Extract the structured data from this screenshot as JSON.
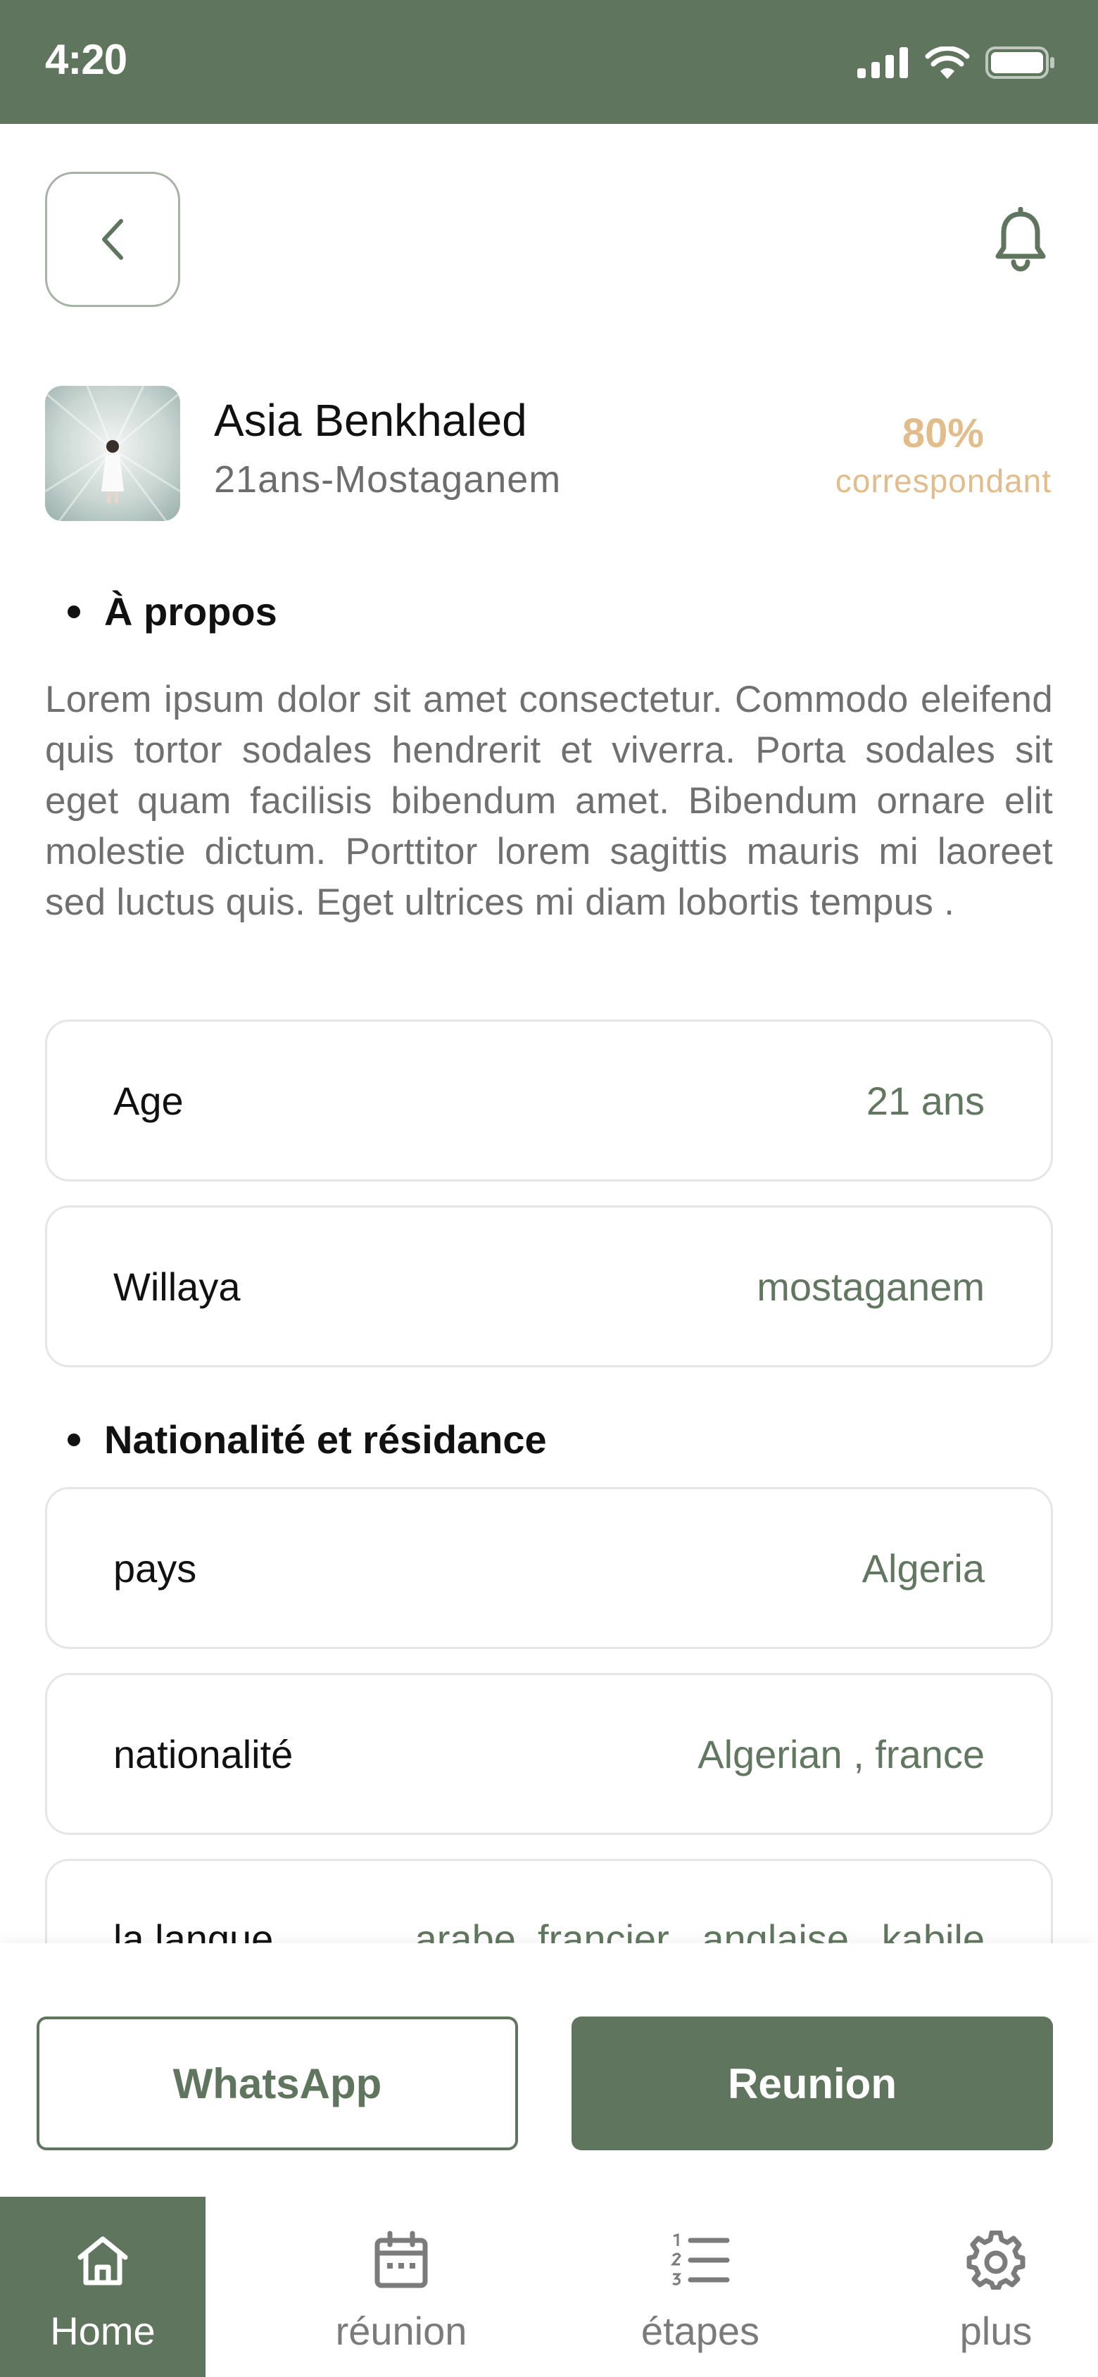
{
  "status_bar": {
    "time": "4:20"
  },
  "header": {
    "back_icon": "chevron-left-icon",
    "notification_icon": "bell-icon"
  },
  "profile": {
    "name": "Asia Benkhaled",
    "subtitle": "21ans-Mostaganem",
    "match_percent": "80%",
    "match_label": "correspondant"
  },
  "about": {
    "title": "À propos",
    "text": "Lorem ipsum dolor sit amet consectetur. Commodo eleifend quis tortor sodales hendrerit et viverra. Porta sodales sit eget quam facilisis bibendum amet. Bibendum ornare elit molestie dictum. Porttitor lorem sagittis mauris mi laoreet sed luctus quis. Eget ultrices mi diam lobortis tempus ."
  },
  "info_rows": [
    {
      "label": "Age",
      "value": "21 ans"
    },
    {
      "label": "Willaya",
      "value": "mostaganem"
    }
  ],
  "nationality_section": {
    "title": "Nationalité et résidance",
    "rows": [
      {
        "label": "pays",
        "value": "Algeria"
      },
      {
        "label": "nationalité",
        "value": "Algerian , france"
      },
      {
        "label": "la langue",
        "value": "arabe, francier , anglaise , kabile"
      }
    ]
  },
  "actions": {
    "whatsapp_label": "WhatsApp",
    "reunion_label": "Reunion"
  },
  "tab_bar": {
    "items": [
      {
        "label": "Home",
        "icon": "home-icon",
        "active": true
      },
      {
        "label": "réunion",
        "icon": "calendar-icon",
        "active": false
      },
      {
        "label": "étapes",
        "icon": "list-numbered-icon",
        "active": false
      },
      {
        "label": "plus",
        "icon": "gear-icon",
        "active": false
      }
    ]
  },
  "colors": {
    "primary": "#5f755e",
    "accent": "#e2bc8a",
    "muted_text": "#707070"
  }
}
